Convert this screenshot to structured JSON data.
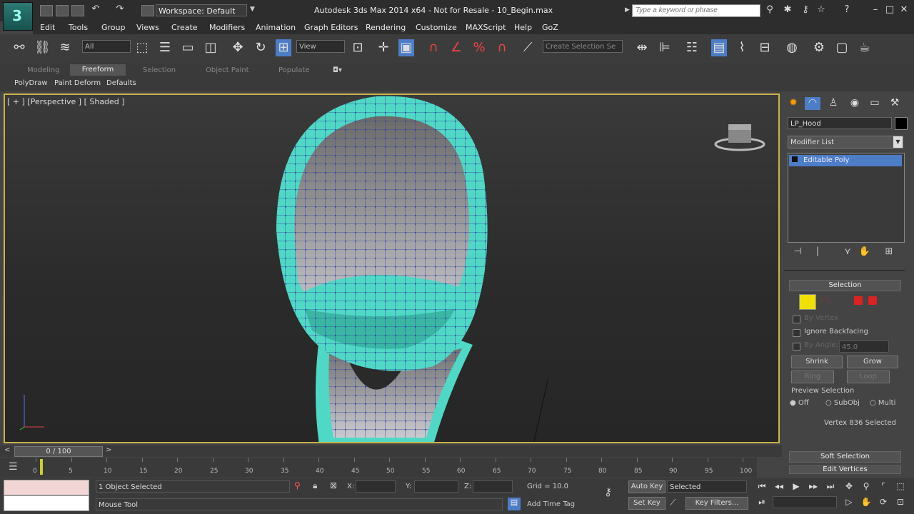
{
  "window": {
    "title": "Autodesk 3ds Max  2014 x64    - Not for Resale -    10_Begin.max",
    "workspace": "Workspace: Default",
    "search_placeholder": "Type a keyword or phrase"
  },
  "menu": [
    "Edit",
    "Tools",
    "Group",
    "Views",
    "Create",
    "Modifiers",
    "Animation",
    "Graph Editors",
    "Rendering",
    "Customize",
    "MAXScript",
    "Help",
    "GoZ"
  ],
  "toolbar": {
    "selection_filter": "All",
    "coord_system": "View",
    "named_selection": "Create Selection Se"
  },
  "ribbon": {
    "tabs": [
      "Modeling",
      "Freeform",
      "Selection",
      "Object Paint",
      "Populate"
    ],
    "active_tab": "Freeform",
    "subtabs": [
      "PolyDraw",
      "Paint Deform",
      "Defaults"
    ]
  },
  "viewport": {
    "label": "[ + ] [Perspective ] [ Shaded ]"
  },
  "command_panel": {
    "object_name": "LP_Hood",
    "modifier_list": "Modifier List",
    "stack_item": "Editable Poly",
    "selection_rollout": "Selection",
    "by_vertex": "By Vertex",
    "ignore_backfacing": "Ignore Backfacing",
    "by_angle": "By Angle:",
    "by_angle_value": "45.0",
    "shrink": "Shrink",
    "grow": "Grow",
    "ring": "Ring",
    "loop": "Loop",
    "preview_selection": "Preview Selection",
    "preview_options": [
      "Off",
      "SubObj",
      "Multi"
    ],
    "selection_status": "Vertex 836 Selected",
    "soft_selection": "Soft Selection",
    "edit_vertices": "Edit Vertices"
  },
  "timeline": {
    "slider": "0 / 100",
    "ticks": [
      "0",
      "5",
      "10",
      "15",
      "20",
      "25",
      "30",
      "35",
      "40",
      "45",
      "50",
      "55",
      "60",
      "65",
      "70",
      "75",
      "80",
      "85",
      "90",
      "95",
      "100"
    ]
  },
  "status": {
    "selected": "1 Object Selected",
    "prompt": "Mouse Tool",
    "x_label": "X:",
    "y_label": "Y:",
    "z_label": "Z:",
    "grid": "Grid = 10.0",
    "add_time_tag": "Add Time Tag",
    "auto_key": "Auto Key",
    "set_key": "Set Key",
    "key_mode": "Selected",
    "key_filters": "Key Filters..."
  },
  "colors": {
    "accent_blue": "#4d7dc7",
    "mesh_cyan": "#4fd8c6",
    "viewport_border": "#c9b44a",
    "vertex_blue": "#1a2fd0"
  }
}
